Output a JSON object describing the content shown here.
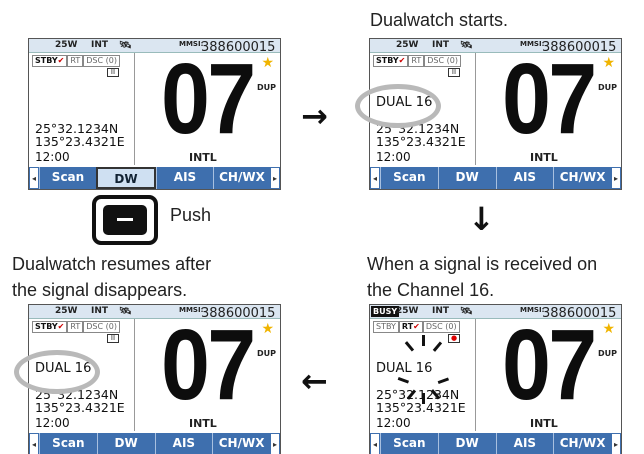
{
  "captions": {
    "top_right": "Dualwatch starts.",
    "mid_left_line1": "Dualwatch resumes after",
    "mid_left_line2": "the signal disappears.",
    "mid_right_line1": "When a signal is received on",
    "mid_right_line2": "the Channel 16.",
    "push": "Push"
  },
  "screen": {
    "power": "25W",
    "int": "INT",
    "gps_icon": "satellite-icon",
    "mmsi_label": "MMSI:",
    "mmsi": "388600015",
    "busy": "BUSY",
    "status_stby": "STBY",
    "status_check": "✔",
    "status_rt": "RT",
    "status_dsc": "DSC (0)",
    "rec_pause": "II",
    "rec_on": "●",
    "channel": "07",
    "dup": "DUP",
    "intl": "INTL",
    "lat": "25°32.1234N",
    "lon": "135°23.4321E",
    "time": "12:00",
    "dual": "DUAL 16",
    "star_icon": "star-icon",
    "softkeys": [
      "Scan",
      "DW",
      "AIS",
      "CH/WX"
    ],
    "left_arrow": "◂",
    "right_arrow": "▸"
  },
  "arrows": {
    "right": "→",
    "down": "↓",
    "left": "←"
  },
  "colors": {
    "softkey_bar": "#3e6fae",
    "topbar": "#dbe6f1",
    "highlight": "#cfe0f2",
    "ellipse": "#b9b9b9",
    "star": "#f0b400"
  }
}
